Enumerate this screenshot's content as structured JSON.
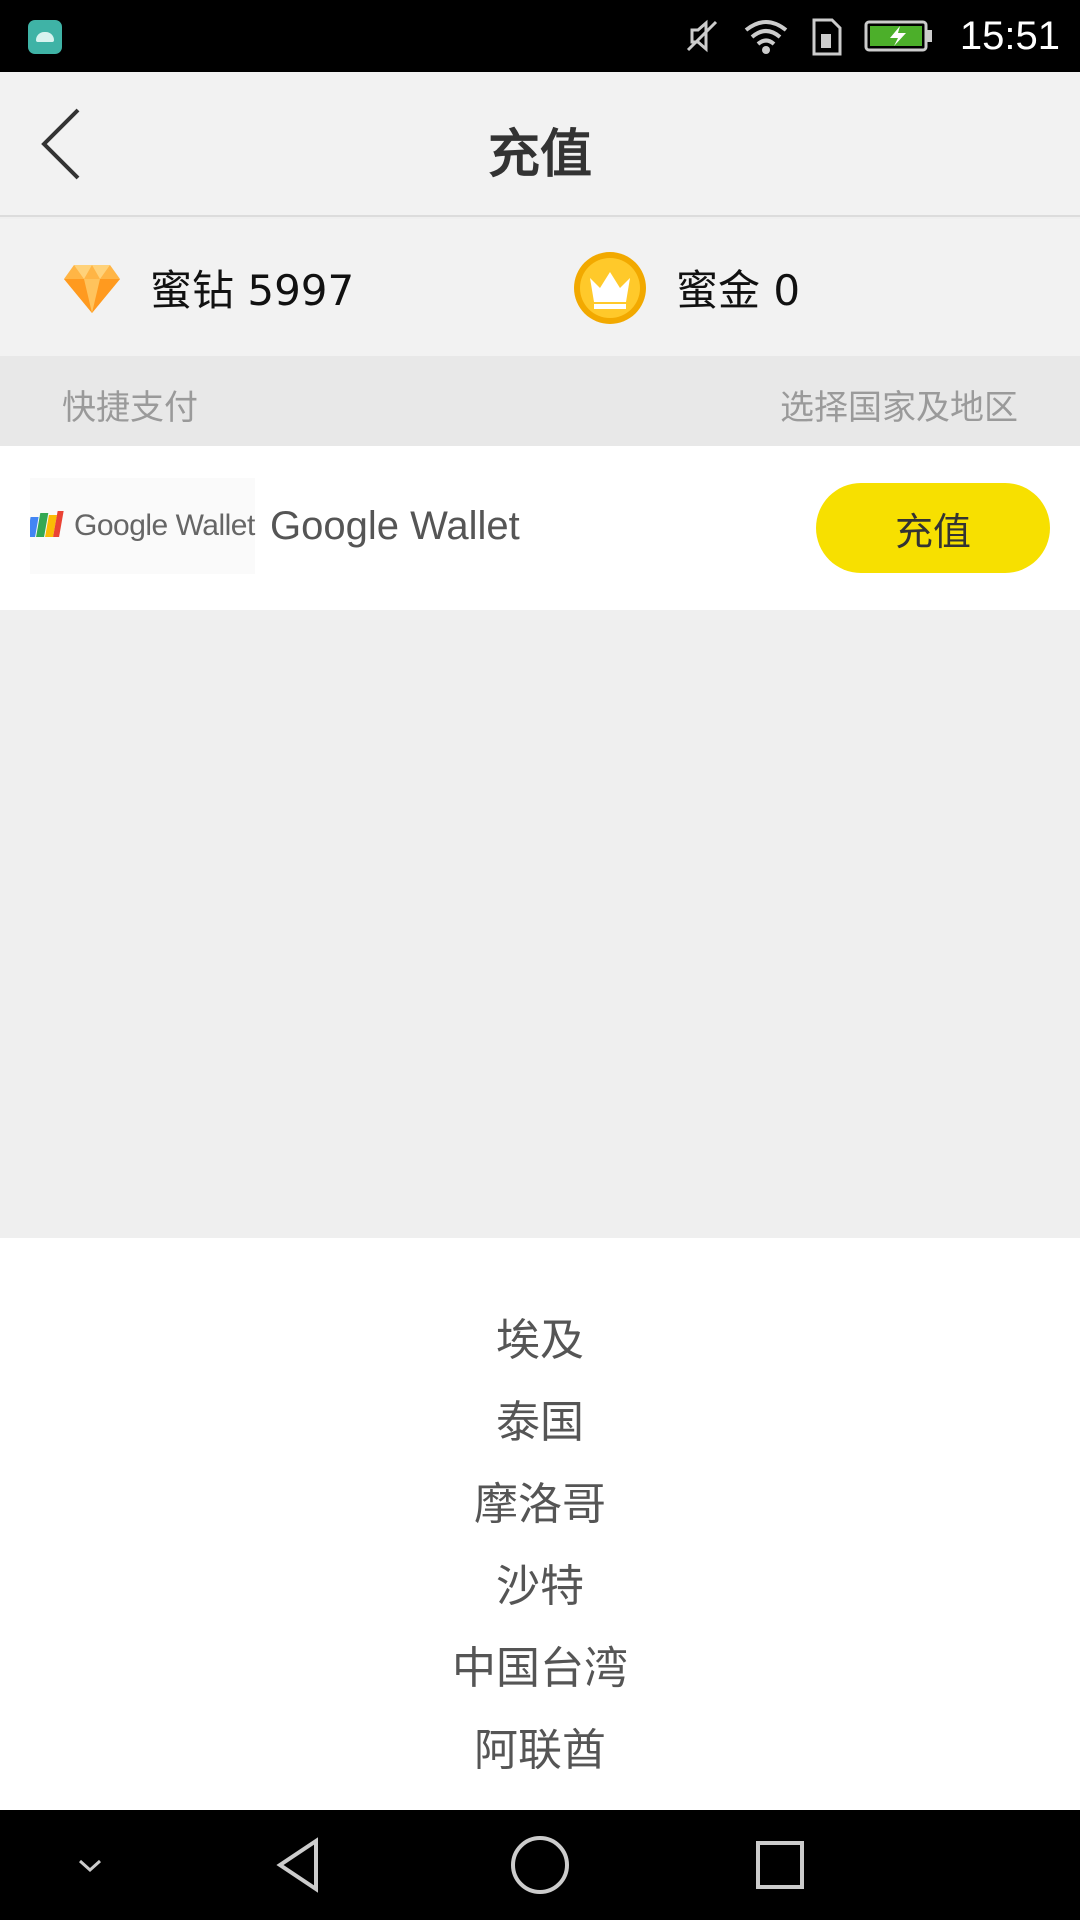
{
  "status_bar": {
    "time": "15:51",
    "icons": [
      "android-app-icon",
      "mute-icon",
      "wifi-icon",
      "sim-icon",
      "battery-charging-icon"
    ]
  },
  "header": {
    "title": "充值",
    "back_icon": "chevron-left-icon"
  },
  "balances": [
    {
      "icon": "diamond-icon",
      "label": "蜜钻 5997"
    },
    {
      "icon": "crown-coin-icon",
      "label": "蜜金 0"
    }
  ],
  "section": {
    "left": "快捷支付",
    "right": "选择国家及地区"
  },
  "payment": {
    "logo_text": "Google Wallet",
    "name": "Google Wallet",
    "button_label": "充值"
  },
  "countries": [
    "埃及",
    "泰国",
    "摩洛哥",
    "沙特",
    "中国台湾",
    "阿联酋"
  ],
  "nav_bar": {
    "icons": [
      "chevron-down-icon",
      "back-triangle-icon",
      "home-circle-icon",
      "recents-square-icon"
    ]
  },
  "colors": {
    "accent_button": "#f7e000",
    "status_bar": "#000000",
    "header_bg": "#f2f2f2"
  }
}
